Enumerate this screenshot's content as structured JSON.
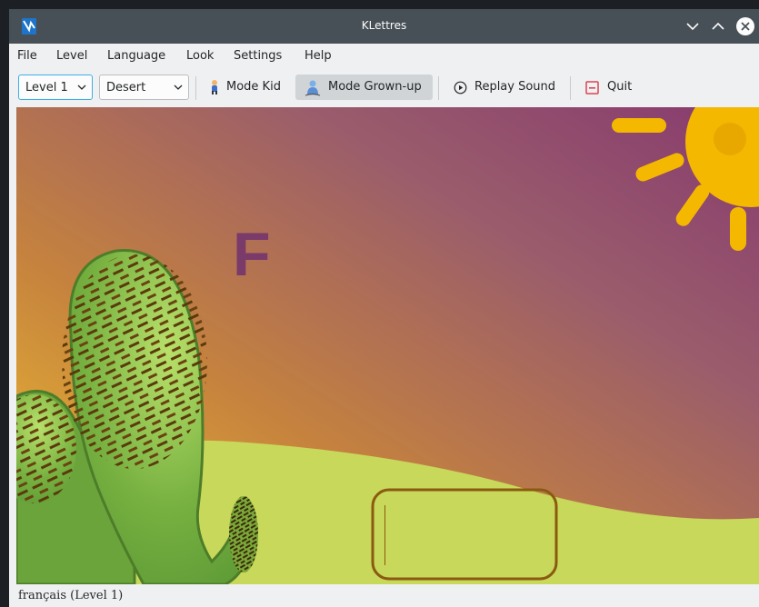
{
  "window": {
    "title": "KLettres"
  },
  "menu": [
    "File",
    "Level",
    "Language",
    "Look",
    "Settings",
    "Help"
  ],
  "toolbar": {
    "level_combo": "Level 1",
    "theme_combo": "Desert",
    "mode_kid": "Mode Kid",
    "mode_grownup": "Mode Grown-up",
    "replay_sound": "Replay Sound",
    "quit": "Quit"
  },
  "stage": {
    "letter": "F",
    "answer_value": ""
  },
  "status": {
    "text": "français  (Level 1)"
  },
  "colors": {
    "letter": "#7a3a6a",
    "answer_box": "#8a5a10",
    "hill": "#c8d85a",
    "sun": "#f5b800",
    "cactus": "#6aa43a"
  },
  "icons": [
    "klettres-app-icon",
    "minimize-icon",
    "maximize-icon",
    "close-icon",
    "kid-icon",
    "grownup-icon",
    "replay-icon",
    "quit-icon",
    "chevron-down-icon"
  ]
}
